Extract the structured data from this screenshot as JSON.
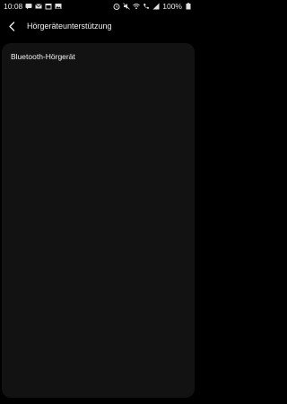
{
  "status_bar": {
    "time": "10:08",
    "battery": "100%",
    "left_icons": [
      "message-icon",
      "mail-icon",
      "calendar-icon",
      "image-icon"
    ],
    "right_icons": [
      "alarm-icon",
      "mute-icon",
      "wifi-icon",
      "call-icon",
      "signal-icon",
      "battery-icon"
    ]
  },
  "header": {
    "title": "Hörgeräteunterstützung",
    "back_icon": "chevron-left-icon"
  },
  "list": {
    "items": [
      {
        "label": "Bluetooth-Hörgerät"
      }
    ]
  },
  "colors": {
    "background": "#000000",
    "card": "#121212",
    "text": "#f4f4f4"
  }
}
